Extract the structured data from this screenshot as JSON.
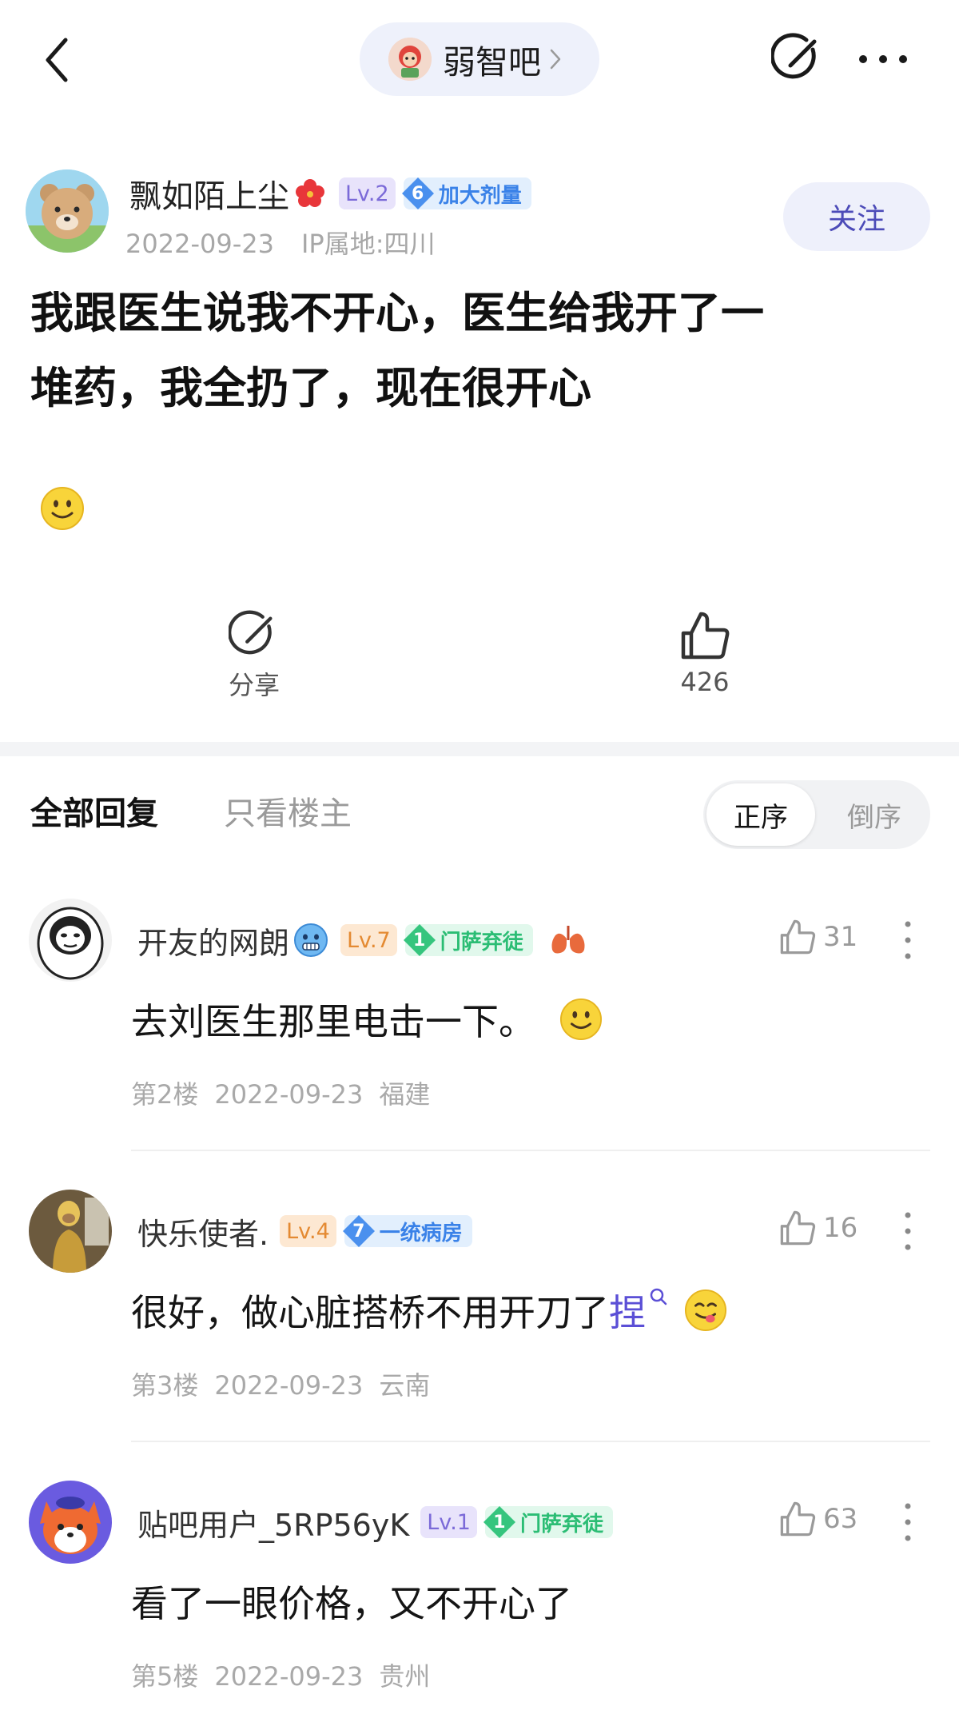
{
  "header": {
    "forum_name": "弱智吧"
  },
  "post": {
    "author": "飘如陌上尘",
    "level": "Lv.2",
    "tag_num": "6",
    "tag_label": "加大剂量",
    "date": "2022-09-23",
    "ip": "IP属地:四川",
    "follow_label": "关注",
    "title_line1": "我跟医生说我不开心，医生给我开了一",
    "title_line2": "堆药，我全扔了，现在很开心",
    "share_label": "分享",
    "like_count": "426"
  },
  "tabs": {
    "all": "全部回复",
    "op_only": "只看楼主",
    "sort_asc": "正序",
    "sort_desc": "倒序"
  },
  "comments": [
    {
      "name": "开友的网朗",
      "level": "Lv.7",
      "tag_num": "1",
      "tag_label": "门萨弃徒",
      "likes": "31",
      "text": "去刘医生那里电击一下。",
      "floor": "第2楼",
      "date": "2022-09-23",
      "location": "福建"
    },
    {
      "name": "快乐使者.",
      "level": "Lv.4",
      "tag_num": "7",
      "tag_label": "一统病房",
      "likes": "16",
      "text": "很好，做心脏搭桥不用开刀了",
      "link_text": "捏",
      "floor": "第3楼",
      "date": "2022-09-23",
      "location": "云南"
    },
    {
      "name": "贴吧用户_5RP56yK",
      "level": "Lv.1",
      "tag_num": "1",
      "tag_label": "门萨弃徒",
      "likes": "63",
      "text": "看了一眼价格，又不开心了",
      "floor": "第5楼",
      "date": "2022-09-23",
      "location": "贵州"
    }
  ],
  "colors": {
    "accent": "#4c4bb8",
    "tag_blue": "#3a82e8",
    "tag_green": "#2bbd74"
  },
  "icons": [
    "back-icon",
    "chevron-right-icon",
    "share-icon",
    "more-icon",
    "like-icon",
    "smile-emoji-icon",
    "yum-emoji-icon",
    "search-icon",
    "gem-icon",
    "flower-icon",
    "lungs-icon",
    "cold-face-icon"
  ]
}
